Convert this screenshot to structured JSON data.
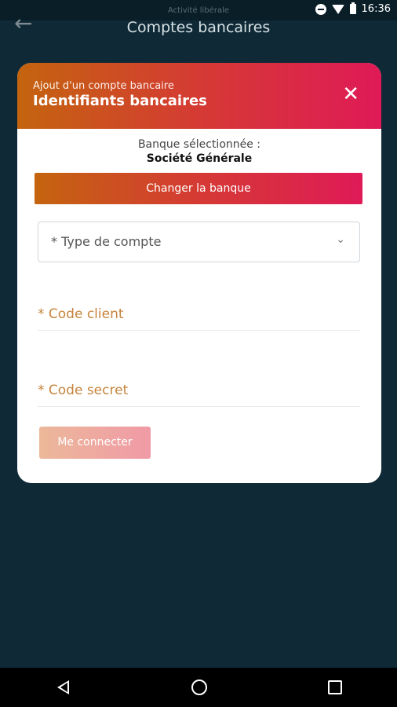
{
  "status": {
    "faint_text": "Activité libérale",
    "time": "16:36"
  },
  "appbar": {
    "title": "Comptes bancaires"
  },
  "card": {
    "subtitle": "Ajout d'un compte bancaire",
    "title": "Identifiants bancaires",
    "bank_label": "Banque sélectionnée :",
    "bank_name": "Société Générale",
    "change_button": "Changer la banque",
    "account_type_placeholder": "* Type de compte",
    "client_code_label": "* Code client",
    "secret_code_label": "* Code secret",
    "connect_button": "Me connecter"
  },
  "colors": {
    "gradient_start": "#c4640f",
    "gradient_end": "#df1a57",
    "background": "#0f2a36",
    "field_label": "#c6843c"
  },
  "icons": [
    "back-arrow-icon",
    "close-icon",
    "chevron-down-icon",
    "dnd-icon",
    "wifi-icon",
    "battery-icon",
    "nav-back-icon",
    "nav-home-icon",
    "nav-recent-icon"
  ]
}
